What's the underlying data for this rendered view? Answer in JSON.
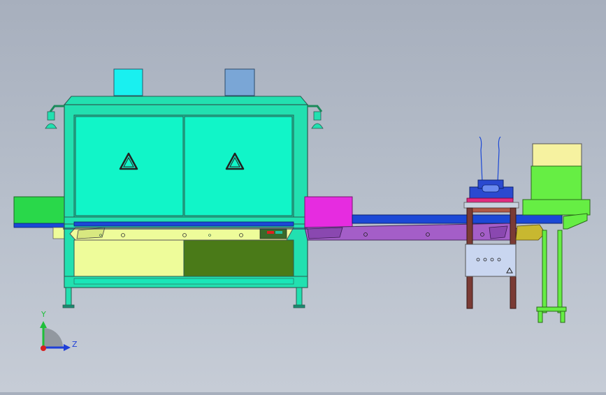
{
  "viewport": {
    "background_top": "#a7afbd",
    "background_bottom": "#c6ccd6"
  },
  "triad": {
    "y_label": "Y",
    "z_label": "Z",
    "y_color": "#1fbf3a",
    "z_color": "#1f3fd8",
    "origin_color": "#d81f1f"
  },
  "colors": {
    "cabinet_frame": "#22e0b0",
    "cabinet_door": "#11f5c8",
    "exhaust_left": "#19f0f0",
    "exhaust_right": "#7aa6d6",
    "infeed_block": "#29d84a",
    "conveyor_belt": "#1b48d6",
    "conveyor_side": "#a45ec8",
    "magenta_box": "#e62ce0",
    "yellow_panel": "#eefc9a",
    "dark_green_panel": "#4a7a18",
    "feeder_head": "#2a49d0",
    "feeder_frame": "#7a3b35",
    "control_box": "#c9d6f0",
    "right_unit": "#66ee44",
    "right_hopper": "#f6f2a0",
    "right_chute": "#c8b830"
  },
  "icons": [
    "warning-triangle-icon",
    "axis-triad-icon",
    "lamp-icon"
  ]
}
